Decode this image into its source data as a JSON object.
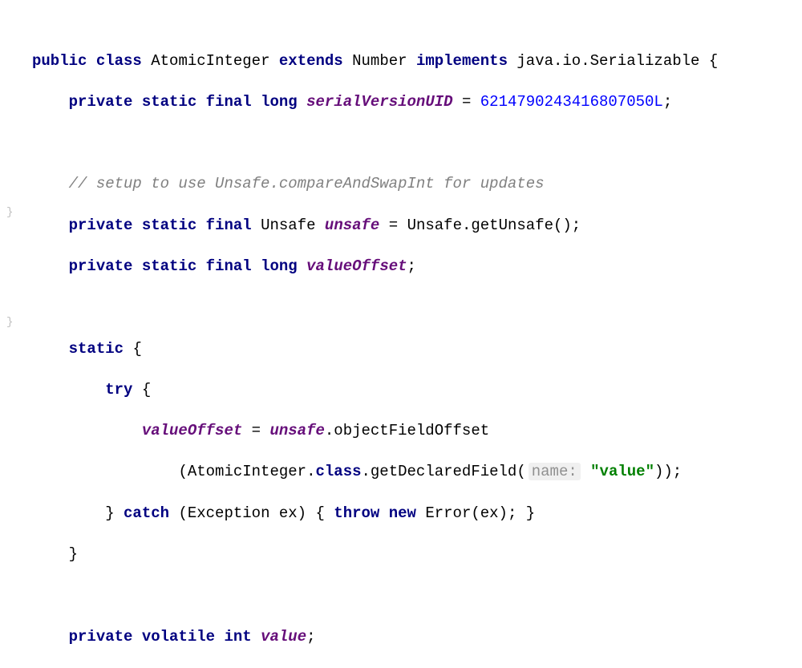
{
  "gutter": {
    "mark1": "}",
    "mark2": "}"
  },
  "code": {
    "kw_public": "public",
    "kw_class": "class",
    "class_name": "AtomicInteger",
    "kw_extends": "extends",
    "super_class": "Number",
    "kw_implements": "implements",
    "iface": "java.io.Serializable",
    "brace_open": "{",
    "kw_private": "private",
    "kw_static": "static",
    "kw_final": "final",
    "kw_long": "long",
    "field_svuid": "serialVersionUID",
    "eq": " = ",
    "svuid_val": "6214790243416807050L",
    "semi": ";",
    "comment1": "// setup to use Unsafe.compareAndSwapInt for updates",
    "type_unsafe": "Unsafe",
    "field_unsafe": "unsafe",
    "unsafe_init": "Unsafe.getUnsafe()",
    "field_valueoffset": "valueOffset",
    "kw_try": "try",
    "assign_vo_lhs": "valueOffset",
    "assign_vo_eq": " = ",
    "unsafe_ref": "unsafe",
    "dot_ofo": ".objectFieldOffset",
    "paren_open": "(",
    "aint_class": "AtomicInteger.",
    "kw_class_lit": "class",
    "gdf": ".getDeclaredField(",
    "hint_name": "name:",
    "str_value": "\"value\"",
    "close_gdf": "));",
    "kw_catch": "catch",
    "catch_params": "(Exception ex) { ",
    "kw_throw": "throw",
    "kw_new": "new",
    "error_expr": "Error(ex); }",
    "brace_close": "}",
    "kw_volatile": "volatile",
    "kw_int": "int",
    "field_value": "value"
  }
}
